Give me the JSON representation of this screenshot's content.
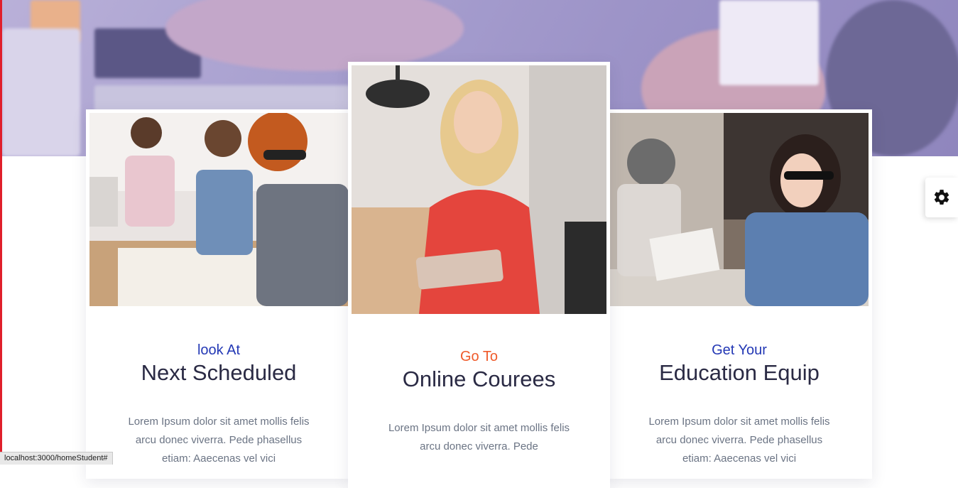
{
  "cards": [
    {
      "subtitle": "look At",
      "title": "Next Scheduled",
      "description": "Lorem Ipsum dolor sit amet mollis felis arcu donec viverra. Pede phasellus etiam: Aaecenas vel vici"
    },
    {
      "subtitle": "Go To",
      "title": "Online Courees",
      "description": "Lorem Ipsum dolor sit amet mollis felis arcu donec viverra. Pede"
    },
    {
      "subtitle": "Get Your",
      "title": "Education Equip",
      "description": "Lorem Ipsum dolor sit amet mollis felis arcu donec viverra. Pede phasellus etiam: Aaecenas vel vici"
    }
  ],
  "settings": {
    "icon": "gear-icon"
  },
  "status_bar": {
    "url": "localhost:3000/homeStudent#"
  },
  "colors": {
    "accent_blue": "#2338b5",
    "accent_orange": "#ef5a2a",
    "heading": "#2a2a44",
    "left_border": "#e01f2b"
  }
}
